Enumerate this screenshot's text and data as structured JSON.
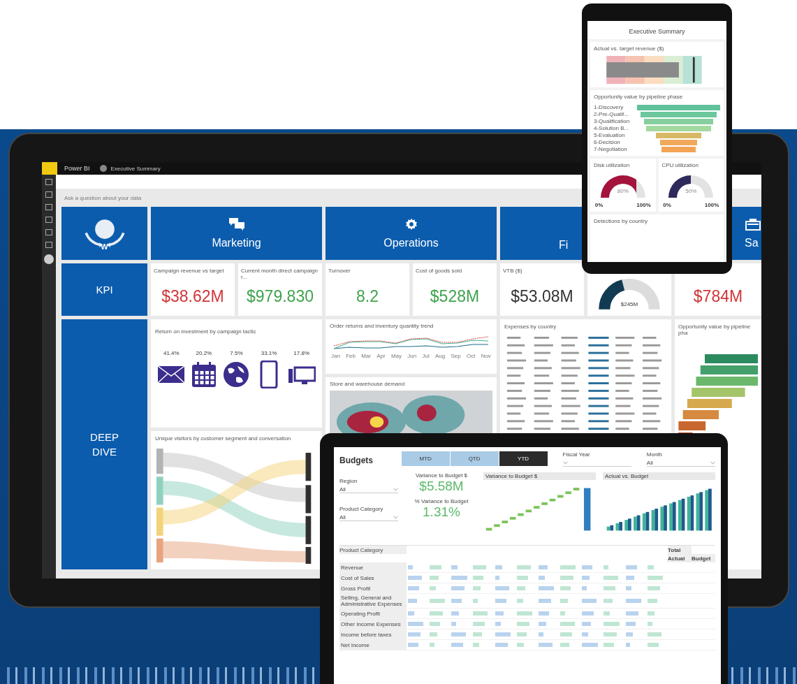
{
  "laptop": {
    "app_name": "Power BI",
    "breadcrumb": "Executive Summary",
    "qa_placeholder": "Ask a question about your data",
    "logo_letter": "W",
    "sections": [
      {
        "label": "Marketing"
      },
      {
        "label": "Operations"
      },
      {
        "label": "Fi"
      },
      {
        "label": "Sa"
      }
    ],
    "row_labels": [
      "KPI",
      "DEEP DIVE"
    ],
    "kpi_tiles": [
      {
        "kind": "card",
        "title": "Campaign revenue vs target",
        "value": "$38.62M",
        "color": "#d13438"
      },
      {
        "kind": "card",
        "title": "Current month direct campaign r...",
        "value": "$979.830",
        "color": "#3fa34d"
      },
      {
        "kind": "card",
        "title": "Turnover",
        "value": "8.2",
        "color": "#3fa34d"
      },
      {
        "kind": "card",
        "title": "Cost of goods sold",
        "value": "$528M",
        "color": "#3fa34d"
      },
      {
        "kind": "card",
        "title": "VTB ($)",
        "value": "$53.08M",
        "color": "#333333"
      },
      {
        "kind": "gauge",
        "value": "$245M",
        "level": 0.42
      },
      {
        "kind": "card",
        "value": "$784M",
        "color": "#d13438"
      }
    ],
    "roi": {
      "title": "Return on investment by campaign tactic",
      "values": [
        "41.4%",
        "20.2%",
        "7.5%",
        "33.1%",
        "17.8%"
      ]
    },
    "trend": {
      "title": "Order returns and inventory quantity trend",
      "months": [
        "Jan",
        "Feb",
        "Mar",
        "Apr",
        "May",
        "Jun",
        "Jul",
        "Aug",
        "Sep",
        "Oct",
        "Nov"
      ]
    },
    "map": {
      "title": "Store and warehouse demand"
    },
    "expenses": {
      "title": "Expenses by country"
    },
    "funnel": {
      "title": "Opportunity value by pipeline pha"
    },
    "sankey": {
      "title": "Unique visitors by customer segment and conversation"
    }
  },
  "phone": {
    "title": "Executive Summary",
    "bullet_title": "Actual vs. target revenue ($)",
    "funnel_title": "Opportunity value by pipeline phase",
    "funnel_stages": [
      "1-Discovery",
      "2-Pre-Qualif...",
      "3-Qualification",
      "4-Solution B...",
      "5-Evaluation",
      "6-Decision",
      "7-Negotiation"
    ],
    "gauges": [
      {
        "title": "Disk utilization",
        "reading": "80%",
        "min": "0%",
        "max": "100%",
        "level": 0.8,
        "color": "#a4133c"
      },
      {
        "title": "CPU utilization",
        "reading": "50%",
        "min": "0%",
        "max": "100%",
        "level": 0.5,
        "color": "#2e2a5c"
      }
    ],
    "footer_title": "Detections by country"
  },
  "tablet": {
    "title": "Budgets",
    "periods": [
      {
        "label": "MTD",
        "selected": false
      },
      {
        "label": "QTD",
        "selected": false
      },
      {
        "label": "YTD",
        "selected": true
      }
    ],
    "top_filters": [
      {
        "label": "Fiscal Year"
      },
      {
        "label": "Month",
        "value": "All"
      }
    ],
    "side_filters": [
      {
        "label": "Region",
        "value": "All"
      },
      {
        "label": "Product Category",
        "value": "All"
      }
    ],
    "kpis": [
      {
        "title": "Variance to Budget $",
        "value": "$5.58M"
      },
      {
        "title": "% Variance to Budget",
        "value": "1.31%"
      }
    ],
    "charts": [
      {
        "kind": "waterfall",
        "title": "Variance to Budget $"
      },
      {
        "kind": "bars",
        "title": "Actual vs. Budget"
      }
    ],
    "table": {
      "first_column": "Product Category",
      "total_column": "Total",
      "total_subheaders": [
        "Actual",
        "Budget"
      ],
      "rows": [
        "Revenue",
        "Cost of Sales",
        "Gross Profit",
        "Selling, General and Administrative Expenses",
        "Operating Profit",
        "Other Income Expenses",
        "Income before taxes",
        "Net Income"
      ]
    }
  }
}
